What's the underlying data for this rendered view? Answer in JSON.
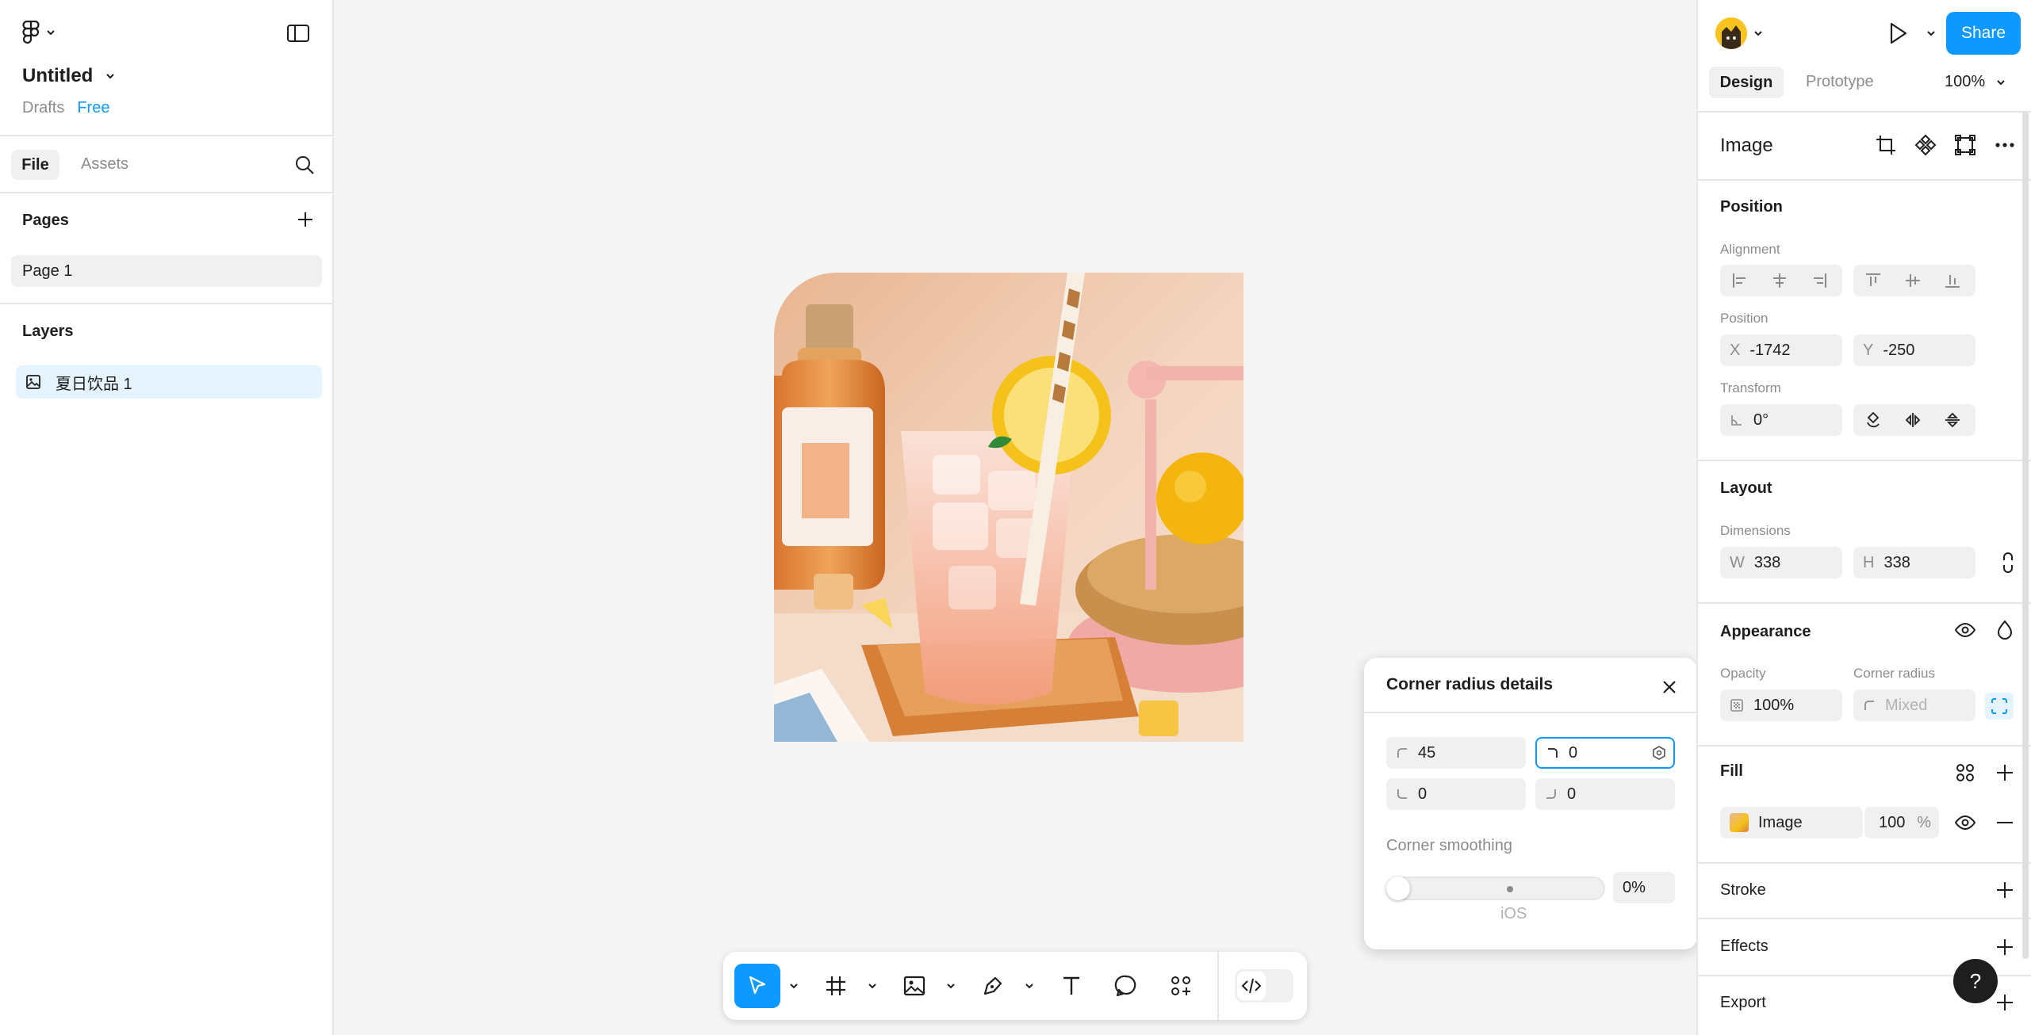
{
  "left_panel": {
    "file_title": "Untitled",
    "drafts_label": "Drafts",
    "plan_badge": "Free",
    "tabs": {
      "file": "File",
      "assets": "Assets"
    },
    "pages_title": "Pages",
    "pages": [
      {
        "label": "Page 1"
      }
    ],
    "layers_title": "Layers",
    "layers": [
      {
        "label": "夏日饮品 1",
        "icon": "image-icon"
      }
    ]
  },
  "canvas": {
    "image_name": "夏日饮品 1",
    "image_description_colors": {
      "background": "#f2c9a6",
      "glass": "#f4b7a4",
      "lemon": "#f5c21b",
      "tray": "#b86a2e"
    }
  },
  "toolbar": {
    "tools": [
      {
        "name": "move-tool",
        "icon": "cursor-icon",
        "active": true
      },
      {
        "name": "frame-tool",
        "icon": "frame-icon"
      },
      {
        "name": "image-tool",
        "icon": "image-icon"
      },
      {
        "name": "pen-tool",
        "icon": "pen-icon"
      },
      {
        "name": "text-tool",
        "icon": "text-icon"
      },
      {
        "name": "comment-tool",
        "icon": "comment-icon"
      },
      {
        "name": "actions-tool",
        "icon": "actions-icon"
      }
    ],
    "dev_mode": "code-icon"
  },
  "corner_radius_popup": {
    "title": "Corner radius details",
    "top_left": "45",
    "top_right": "0",
    "bottom_left": "0",
    "bottom_right": "0",
    "smoothing_label": "Corner smoothing",
    "smoothing_value": "0%",
    "smoothing_preset": "iOS"
  },
  "right_panel": {
    "share_label": "Share",
    "tabs": {
      "design": "Design",
      "prototype": "Prototype"
    },
    "zoom": "100%",
    "selection_title": "Image",
    "position": {
      "title": "Position",
      "alignment_label": "Alignment",
      "position_label": "Position",
      "x_prefix": "X",
      "x": "-1742",
      "y_prefix": "Y",
      "y": "-250",
      "transform_label": "Transform",
      "rotation": "0°"
    },
    "layout": {
      "title": "Layout",
      "dimensions_label": "Dimensions",
      "w_prefix": "W",
      "w": "338",
      "h_prefix": "H",
      "h": "338"
    },
    "appearance": {
      "title": "Appearance",
      "opacity_label": "Opacity",
      "opacity": "100%",
      "corner_radius_label": "Corner radius",
      "corner_radius_placeholder": "Mixed"
    },
    "fill": {
      "title": "Fill",
      "type": "Image",
      "opacity": "100",
      "unit": "%"
    },
    "stroke_title": "Stroke",
    "effects_title": "Effects",
    "export_title": "Export"
  },
  "colors": {
    "accent": "#0d99ff",
    "selected_layer_bg": "#e5f4ff"
  }
}
